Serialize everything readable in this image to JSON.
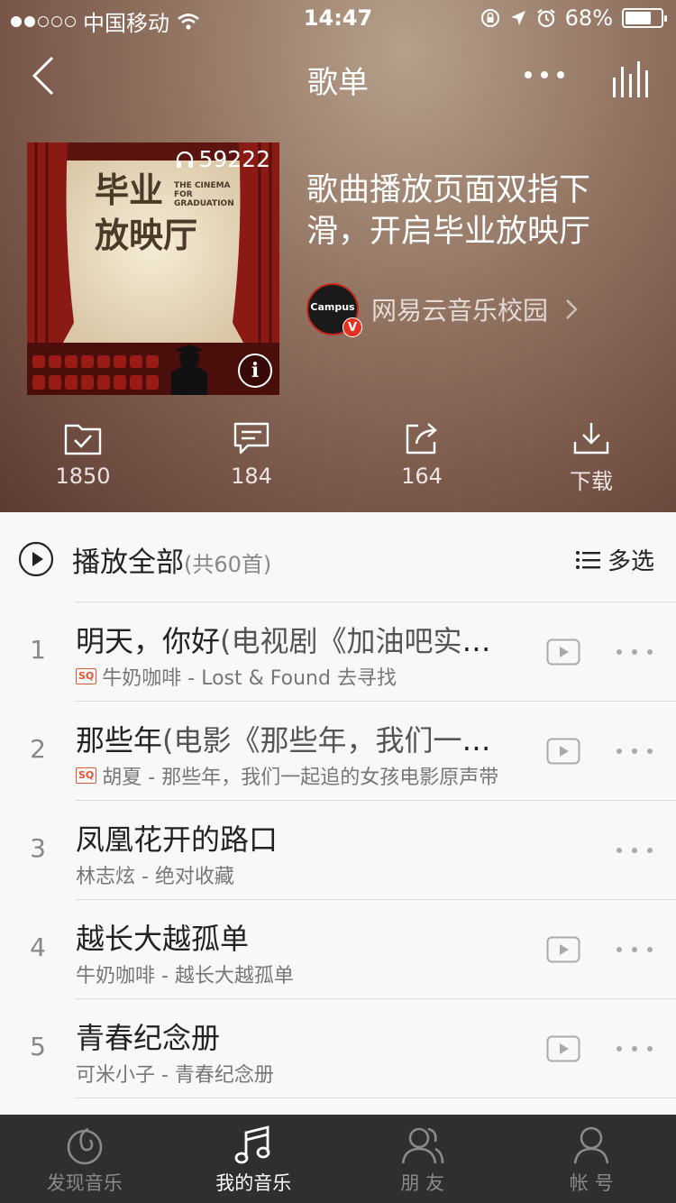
{
  "status": {
    "carrier": "中国移动",
    "time": "14:47",
    "battery": "68%",
    "battery_level": 0.68
  },
  "nav": {
    "title": "歌单"
  },
  "cover": {
    "play_count": "59222",
    "cover_title_cn": "毕业放映厅",
    "cover_title_en_1": "THE CINEMA",
    "cover_title_en_2": "FOR",
    "cover_title_en_3": "GRADUATION"
  },
  "playlist": {
    "title": "歌曲播放页面双指下滑，开启毕业放映厅",
    "creator": "网易云音乐校园",
    "creator_avatar_text": "Campus",
    "creator_badge": "V"
  },
  "actions": [
    {
      "label": "1850"
    },
    {
      "label": "184"
    },
    {
      "label": "164"
    },
    {
      "label": "下载"
    }
  ],
  "play_all": {
    "label": "播放全部",
    "count": "(共60首)",
    "multi_select": "多选"
  },
  "songs": [
    {
      "num": "1",
      "title": "明天，你好",
      "title_ext": "(电视剧《加油吧实习生》插曲)",
      "sub": "牛奶咖啡 - Lost & Found 去寻找",
      "sq": "SQ",
      "has_mv": true
    },
    {
      "num": "2",
      "title": "那些年",
      "title_ext": "(电影《那些年，我们一起追的女孩》主题曲)",
      "sub": "胡夏 - 那些年，我们一起追的女孩电影原声带",
      "sq": "SQ",
      "has_mv": true
    },
    {
      "num": "3",
      "title": "凤凰花开的路口",
      "title_ext": "",
      "sub": "林志炫 - 绝对收藏",
      "sq": "",
      "has_mv": false
    },
    {
      "num": "4",
      "title": "越长大越孤单",
      "title_ext": "",
      "sub": "牛奶咖啡 - 越长大越孤单",
      "sq": "",
      "has_mv": true
    },
    {
      "num": "5",
      "title": "青春纪念册",
      "title_ext": "",
      "sub": "可米小子 - 青春纪念册",
      "sq": "",
      "has_mv": true
    }
  ],
  "tabs": [
    {
      "label": "发现音乐",
      "icon": "netease-logo-icon",
      "active": false
    },
    {
      "label": "我的音乐",
      "icon": "music-note-icon",
      "active": true
    },
    {
      "label": "朋 友",
      "icon": "friends-icon",
      "active": false
    },
    {
      "label": "帐 号",
      "icon": "account-icon",
      "active": false
    }
  ]
}
